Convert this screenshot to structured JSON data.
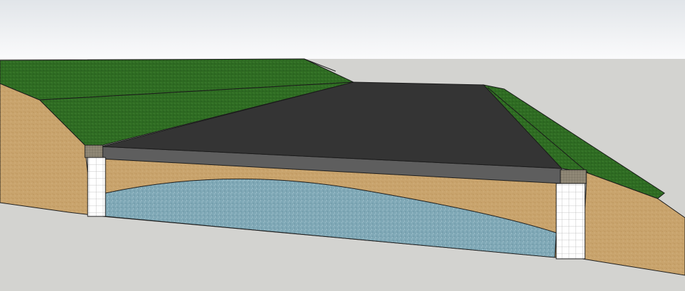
{
  "scene": {
    "kind": "road-cross-section-model",
    "layers": [
      {
        "name": "grass-embankment",
        "color": "#2f6a22"
      },
      {
        "name": "asphalt-surface",
        "color": "#343434"
      },
      {
        "name": "base-course",
        "color": "#5f5f5f"
      },
      {
        "name": "soil",
        "color": "#c8a36c"
      },
      {
        "name": "water-or-gravel-lens",
        "color": "#7ea6b4"
      },
      {
        "name": "gabion-wall",
        "color": "#ffffff"
      },
      {
        "name": "wall-cap",
        "color": "#8b8372"
      }
    ],
    "sky": {
      "top": "#e2e6ea",
      "bottom": "#f8f9fa"
    },
    "ground": "#d3d3d0"
  }
}
